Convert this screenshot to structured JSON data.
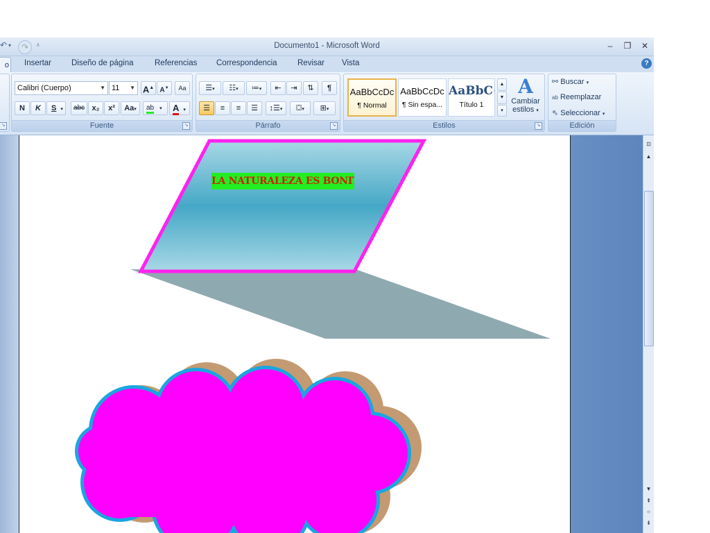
{
  "window": {
    "title": "Documento1 - Microsoft Word",
    "qat_undo": "↶",
    "qat_redo": "↷",
    "qat_more": "⯆",
    "minimize": "–",
    "restore": "❐",
    "close": "✕"
  },
  "tabs": {
    "active_fragment": "o",
    "items": [
      "Insertar",
      "Diseño de página",
      "Referencias",
      "Correspondencia",
      "Revisar",
      "Vista"
    ],
    "help": "?"
  },
  "fuente": {
    "label": "Fuente",
    "font_name": "Calibri (Cuerpo)",
    "font_size": "11",
    "grow": "A",
    "shrink": "A",
    "clear": "Aa",
    "bold": "N",
    "italic": "K",
    "underline": "S",
    "strike": "abc",
    "subscript": "x₂",
    "superscript": "x²",
    "change_case": "Aa",
    "highlight": "ab",
    "font_color": "A"
  },
  "parrafo": {
    "label": "Párrafo"
  },
  "estilos": {
    "label": "Estilos",
    "items": [
      {
        "sample": "AaBbCcDc",
        "name": "¶ Normal"
      },
      {
        "sample": "AaBbCcDc",
        "name": "¶ Sin espa..."
      },
      {
        "sample": "AaBbC(",
        "name": "Título 1"
      }
    ],
    "change_styles_line1": "Cambiar",
    "change_styles_line2": "estilos"
  },
  "edicion": {
    "label": "Edición",
    "find": "Buscar",
    "replace": "Reemplazar",
    "select": "Seleccionar"
  },
  "document": {
    "wordart_text": "LA NATURALEZA ES BONITA"
  },
  "colors": {
    "ribbon": "#d6e4f5",
    "shape_border": "#ff22ee",
    "shape_fill": "#4aa9c8",
    "shadow": "#8fa9b0",
    "cloud_fill": "#ff00ff",
    "cloud_border": "#1aa6df",
    "cloud_shadow": "#c39a72",
    "wordart_bg": "#22ee22",
    "wordart_text": "#cc2200"
  }
}
